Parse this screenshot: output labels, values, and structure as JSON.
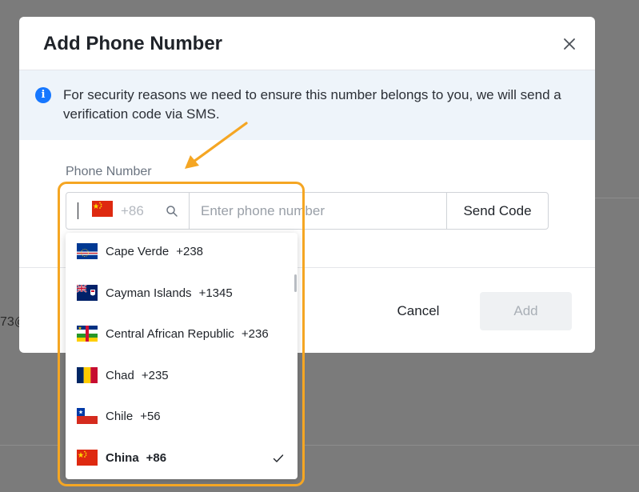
{
  "background": {
    "fragment_text": "73@"
  },
  "modal": {
    "title": "Add Phone Number",
    "close_icon": "close-icon",
    "info": {
      "icon": "info-icon",
      "icon_glyph": "i",
      "text": "For security reasons we need to ensure this number belongs to you, we will send a verification code via SMS."
    },
    "phone_field": {
      "label": "Phone Number",
      "selected_country_code": "+86",
      "selected_flag": "china",
      "search_icon": "search-icon",
      "placeholder": "Enter phone number",
      "value": "",
      "send_code_label": "Send Code"
    },
    "footer": {
      "cancel_label": "Cancel",
      "add_label": "Add",
      "add_enabled": false
    }
  },
  "country_dropdown": {
    "items": [
      {
        "name": "Cape Verde",
        "code": "+238",
        "flag": "cape-verde",
        "selected": false
      },
      {
        "name": "Cayman Islands",
        "code": "+1345",
        "flag": "cayman-islands",
        "selected": false
      },
      {
        "name": "Central African Republic",
        "code": "+236",
        "flag": "central-african-republic",
        "selected": false
      },
      {
        "name": "Chad",
        "code": "+235",
        "flag": "chad",
        "selected": false
      },
      {
        "name": "Chile",
        "code": "+56",
        "flag": "chile",
        "selected": false
      },
      {
        "name": "China",
        "code": "+86",
        "flag": "china",
        "selected": true
      }
    ]
  },
  "annotation": {
    "highlight_color": "#f5a623"
  },
  "colors": {
    "accent": "#1677ff",
    "overlay": "#7b7b7b",
    "info_bg": "#eef4fa",
    "disabled_button_bg": "#eff1f3"
  }
}
